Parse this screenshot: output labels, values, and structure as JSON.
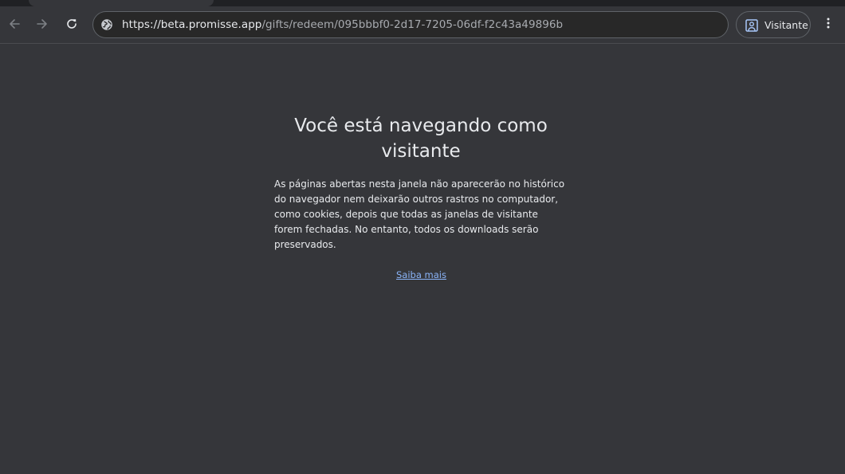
{
  "browser": {
    "toolbar": {
      "back_icon": "arrow-left-icon",
      "forward_icon": "arrow-right-icon",
      "reload_icon": "reload-icon",
      "menu_icon": "vertical-dots-icon"
    },
    "omnibox": {
      "site_icon": "site-info-icon",
      "url_host": "https://beta.promisse.app",
      "url_path": "/gifts/redeem/095bbbf0-2d17-7205-06df-f2c43a49896b"
    },
    "profile": {
      "icon": "guest-profile-icon",
      "label": "Visitante"
    }
  },
  "page": {
    "title": "Você está navegando como visitante",
    "description": "As páginas abertas nesta janela não aparecerão no histórico do navegador nem deixarão outros rastros no computador, como cookies, depois que todas as janelas de visitante forem fechadas. No entanto, todos os downloads serão preservados.",
    "learn_more_link": "Saiba mais"
  },
  "colors": {
    "background": "#35363a",
    "tabstrip": "#202124",
    "omnibox_bg": "#282828",
    "text_primary": "#e8eaed",
    "text_secondary": "#a8abb0",
    "link": "#8ab4f8"
  }
}
